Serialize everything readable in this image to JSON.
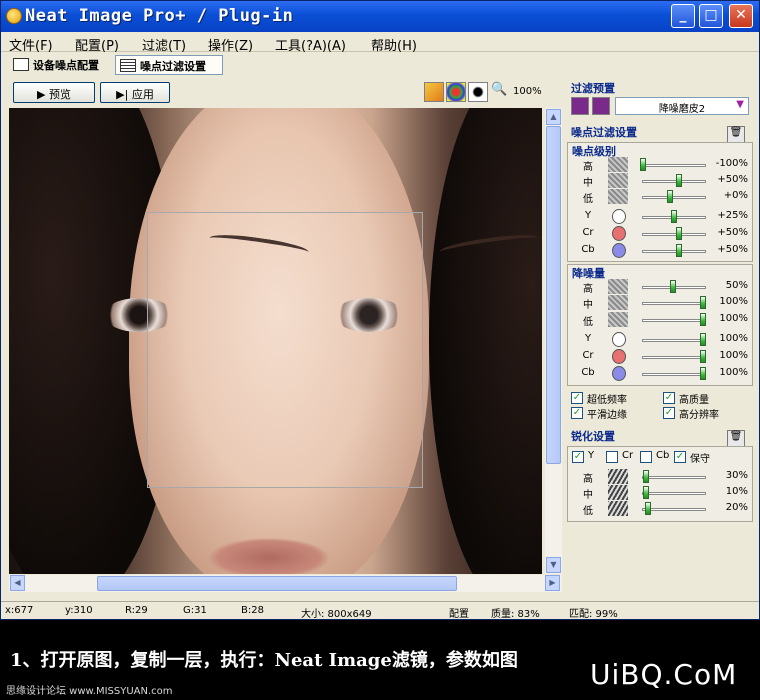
{
  "window": {
    "title": "Neat Image Pro+ / Plug-in",
    "controls": {
      "min": "_",
      "max": "□",
      "close": "✕"
    }
  },
  "menu": [
    "文件(F)",
    "配置(P)",
    "过滤(T)",
    "操作(Z)",
    "工具(?A)(A)",
    "帮助(H)"
  ],
  "tabs": [
    {
      "label": "设备噪点配置",
      "icon": "camera-icon"
    },
    {
      "label": "噪点过滤设置",
      "icon": "filter-settings-icon",
      "active": true
    }
  ],
  "toolbar": {
    "preview_label": "▶ 预览",
    "apply_label": "▶| 应用",
    "zoom": "100%"
  },
  "status": {
    "x": "x:677",
    "y": "y:310",
    "r": "R:29",
    "g": "G:31",
    "b": "B:28",
    "size": "大小: 800x649",
    "profile": "配置",
    "quality": "质量: 83%",
    "match": "匹配: 99%"
  },
  "panel": {
    "preset_title": "过滤预置",
    "preset_value": "降噪磨皮2",
    "noise_filter_title": "噪点过滤设置",
    "noise_level": {
      "title": "噪点级别",
      "rows": [
        {
          "label": "高",
          "value": "-100%",
          "level": 0.0,
          "swatch": "noise"
        },
        {
          "label": "中",
          "value": "+50%",
          "level": 0.6,
          "swatch": "noise"
        },
        {
          "label": "低",
          "value": "+0%",
          "level": 0.45,
          "swatch": "noise"
        },
        {
          "label": "Y",
          "value": "+25%",
          "level": 0.52,
          "swatch": "white",
          "color": "#ffffff"
        },
        {
          "label": "Cr",
          "value": "+50%",
          "level": 0.6,
          "swatch": "red",
          "color": "#e87070"
        },
        {
          "label": "Cb",
          "value": "+50%",
          "level": 0.6,
          "swatch": "blue",
          "color": "#8a8ae8"
        }
      ]
    },
    "noise_reduction": {
      "title": "降噪量",
      "rows": [
        {
          "label": "高",
          "value": "50%",
          "level": 0.5,
          "swatch": "noise"
        },
        {
          "label": "中",
          "value": "100%",
          "level": 1.0,
          "swatch": "noise"
        },
        {
          "label": "低",
          "value": "100%",
          "level": 1.0,
          "swatch": "noise"
        },
        {
          "label": "Y",
          "value": "100%",
          "level": 1.0,
          "swatch": "white",
          "color": "#ffffff"
        },
        {
          "label": "Cr",
          "value": "100%",
          "level": 1.0,
          "swatch": "red",
          "color": "#e87070"
        },
        {
          "label": "Cb",
          "value": "100%",
          "level": 1.0,
          "swatch": "blue",
          "color": "#8a8ae8"
        }
      ]
    },
    "options": [
      {
        "label": "超低频率",
        "checked": true
      },
      {
        "label": "高质量",
        "checked": true
      },
      {
        "label": "平滑边缘",
        "checked": true
      },
      {
        "label": "高分辨率",
        "checked": true
      }
    ],
    "sharpen": {
      "title": "锐化设置",
      "channels": [
        {
          "label": "Y",
          "checked": true
        },
        {
          "label": "Cr",
          "checked": false
        },
        {
          "label": "Cb",
          "checked": false
        },
        {
          "label": "保守",
          "checked": true
        }
      ],
      "rows": [
        {
          "label": "高",
          "value": "30%",
          "level": 0.05,
          "swatch": "stripes"
        },
        {
          "label": "中",
          "value": "10%",
          "level": 0.05,
          "swatch": "stripes"
        },
        {
          "label": "低",
          "value": "20%",
          "level": 0.08,
          "swatch": "stripes"
        }
      ]
    }
  },
  "caption": "1、打开原图，复制一层，执行：Neat Image滤镜，参数如图",
  "watermark_left": "思缘设计论坛 www.MISSYUAN.com",
  "watermark_right": "UiBQ.CoM"
}
